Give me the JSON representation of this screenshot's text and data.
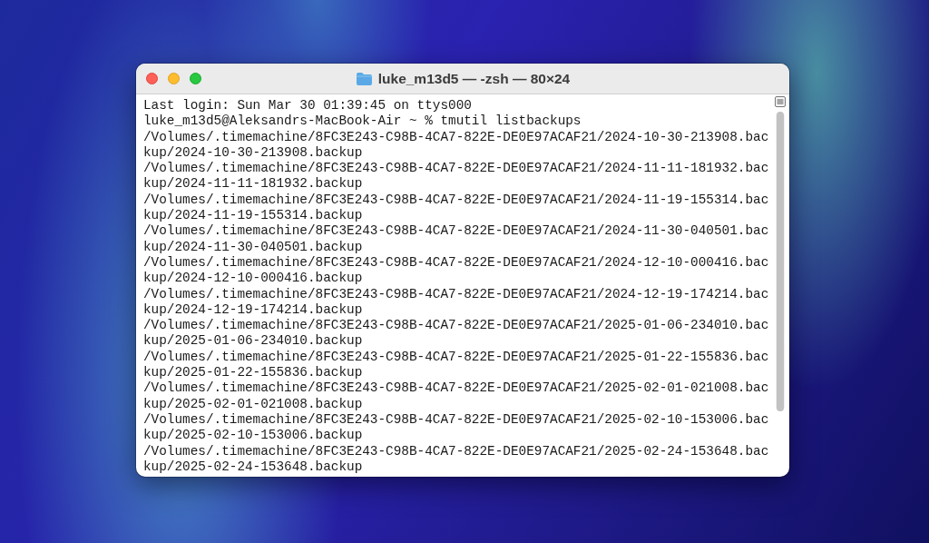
{
  "window": {
    "title": "luke_m13d5 — -zsh — 80×24"
  },
  "terminal": {
    "lines": [
      "Last login: Sun Mar 30 01:39:45 on ttys000",
      "luke_m13d5@Aleksandrs-MacBook-Air ~ % tmutil listbackups",
      "/Volumes/.timemachine/8FC3E243-C98B-4CA7-822E-DE0E97ACAF21/2024-10-30-213908.bac",
      "kup/2024-10-30-213908.backup",
      "/Volumes/.timemachine/8FC3E243-C98B-4CA7-822E-DE0E97ACAF21/2024-11-11-181932.bac",
      "kup/2024-11-11-181932.backup",
      "/Volumes/.timemachine/8FC3E243-C98B-4CA7-822E-DE0E97ACAF21/2024-11-19-155314.bac",
      "kup/2024-11-19-155314.backup",
      "/Volumes/.timemachine/8FC3E243-C98B-4CA7-822E-DE0E97ACAF21/2024-11-30-040501.bac",
      "kup/2024-11-30-040501.backup",
      "/Volumes/.timemachine/8FC3E243-C98B-4CA7-822E-DE0E97ACAF21/2024-12-10-000416.bac",
      "kup/2024-12-10-000416.backup",
      "/Volumes/.timemachine/8FC3E243-C98B-4CA7-822E-DE0E97ACAF21/2024-12-19-174214.bac",
      "kup/2024-12-19-174214.backup",
      "/Volumes/.timemachine/8FC3E243-C98B-4CA7-822E-DE0E97ACAF21/2025-01-06-234010.bac",
      "kup/2025-01-06-234010.backup",
      "/Volumes/.timemachine/8FC3E243-C98B-4CA7-822E-DE0E97ACAF21/2025-01-22-155836.bac",
      "kup/2025-01-22-155836.backup",
      "/Volumes/.timemachine/8FC3E243-C98B-4CA7-822E-DE0E97ACAF21/2025-02-01-021008.bac",
      "kup/2025-02-01-021008.backup",
      "/Volumes/.timemachine/8FC3E243-C98B-4CA7-822E-DE0E97ACAF21/2025-02-10-153006.bac",
      "kup/2025-02-10-153006.backup",
      "/Volumes/.timemachine/8FC3E243-C98B-4CA7-822E-DE0E97ACAF21/2025-02-24-153648.bac",
      "kup/2025-02-24-153648.backup"
    ]
  }
}
